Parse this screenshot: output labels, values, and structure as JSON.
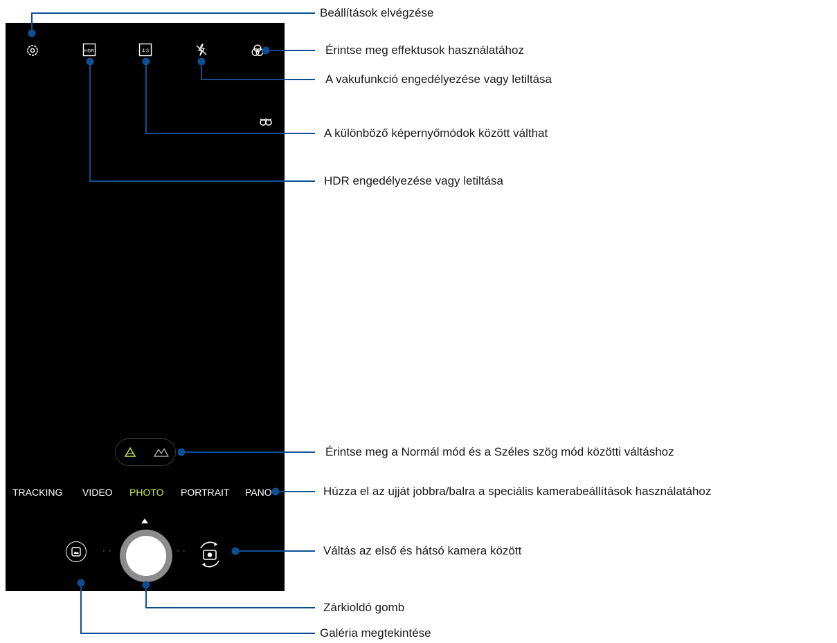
{
  "camera": {
    "modes": [
      "TRACKING",
      "VIDEO",
      "PHOTO",
      "PORTRAIT",
      "PANO"
    ],
    "active_mode": "PHOTO",
    "top_icons": [
      "settings-icon",
      "hdr-icon",
      "aspect-ratio-icon",
      "flash-off-icon",
      "effects-icon"
    ],
    "aspect_label": "4:3",
    "hdr_label": "HDR"
  },
  "annotations": {
    "settings": "Beállítások elvégzése",
    "effects": "Érintse meg effektusok használatához",
    "flash": "A vakufunkció engedélyezése vagy letiltása",
    "aspect": "A különböző képernyőmódok között válthat",
    "hdr": "HDR engedélyezése vagy letiltása",
    "lens": "Érintse meg a Normál mód és a Széles szög mód közötti váltáshoz",
    "modes": "Húzza el az ujját jobbra/balra a speciális kamerabeállítások használatához",
    "switch_camera": "Váltás az első és hátsó kamera között",
    "shutter": "Zárkioldó gomb",
    "gallery": "Galéria megtekintése"
  },
  "colors": {
    "callout_line": "#0c4f95",
    "active_mode": "#c6e84a",
    "screen_bg": "#000000"
  }
}
